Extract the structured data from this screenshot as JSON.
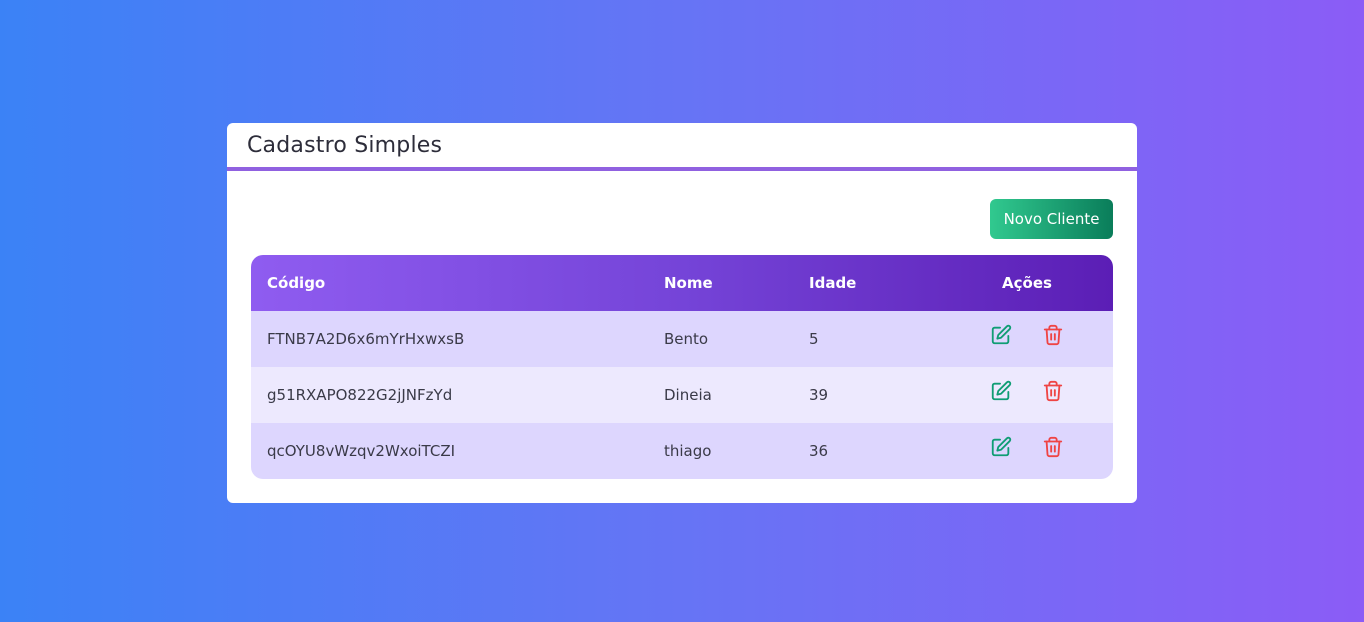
{
  "page": {
    "title": "Cadastro Simples"
  },
  "toolbar": {
    "new_client_label": "Novo Cliente"
  },
  "table": {
    "headers": {
      "code": "Código",
      "name": "Nome",
      "age": "Idade",
      "actions": "Ações"
    },
    "rows": [
      {
        "code": "FTNB7A2D6x6mYrHxwxsB",
        "name": "Bento",
        "age": "5"
      },
      {
        "code": "g51RXAPO822G2jJNFzYd",
        "name": "Dineia",
        "age": "39"
      },
      {
        "code": "qcOYU8vWzqv2WxoiTCZI",
        "name": "thiago",
        "age": "36"
      }
    ]
  },
  "icons": {
    "edit": "edit-icon",
    "delete": "trash-icon"
  },
  "colors": {
    "accent_purple": "#8b5cf6",
    "button_green": "#31c98f",
    "edit_green": "#0f9d74",
    "delete_red": "#ef4444"
  }
}
